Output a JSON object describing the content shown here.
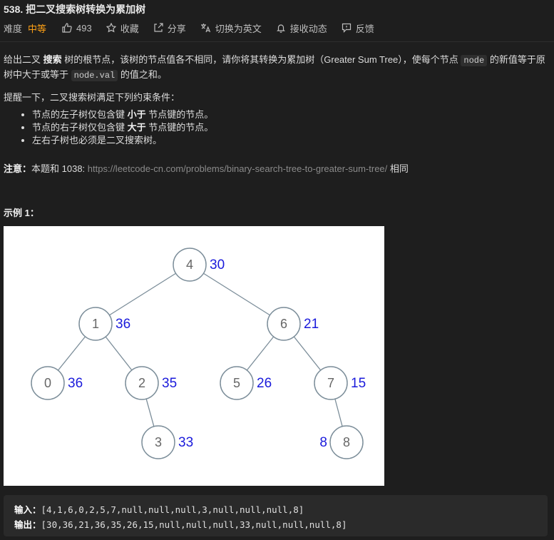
{
  "header": {
    "title": "538. 把二叉搜索树转换为累加树"
  },
  "toolbar": {
    "difficulty_label": "难度",
    "difficulty_value": "中等",
    "likes_count": "493",
    "favorite_label": "收藏",
    "share_label": "分享",
    "translate_label": "切换为英文",
    "notify_label": "接收动态",
    "feedback_label": "反馈"
  },
  "description": {
    "p1_a": "给出二叉 ",
    "p1_bold": "搜索",
    "p1_b": " 树的根节点，该树的节点值各不相同，请你将其转换为累加树（Greater Sum Tree），使每个节点 ",
    "p1_code1": "node",
    "p1_c": " 的新值等于原树中大于或等于 ",
    "p1_code2": "node.val",
    "p1_d": " 的值之和。",
    "reminder": "提醒一下，二叉搜索树满足下列约束条件：",
    "constraints": [
      {
        "a": "节点的左子树仅包含键 ",
        "b": "小于",
        "c": " 节点键的节点。"
      },
      {
        "a": "节点的右子树仅包含键 ",
        "b": "大于",
        "c": " 节点键的节点。"
      },
      {
        "a": "左右子树也必须是二叉搜索树。",
        "b": "",
        "c": ""
      }
    ],
    "note_label": "注意：",
    "note_text": "本题和 1038: ",
    "note_link": "https://leetcode-cn.com/problems/binary-search-tree-to-greater-sum-tree/",
    "note_tail": " 相同"
  },
  "example": {
    "title": "示例 1：",
    "input_label": "输入：",
    "input_value": "[4,1,6,0,2,5,7,null,null,null,3,null,null,null,8]",
    "output_label": "输出：",
    "output_value": "[30,36,21,36,35,26,15,null,null,null,33,null,null,null,8]"
  },
  "tree": {
    "nodes": [
      {
        "id": "n4",
        "val": "4",
        "sum": "30"
      },
      {
        "id": "n1",
        "val": "1",
        "sum": "36"
      },
      {
        "id": "n6",
        "val": "6",
        "sum": "21"
      },
      {
        "id": "n0",
        "val": "0",
        "sum": "36"
      },
      {
        "id": "n2",
        "val": "2",
        "sum": "35"
      },
      {
        "id": "n5",
        "val": "5",
        "sum": "26"
      },
      {
        "id": "n7",
        "val": "7",
        "sum": "15"
      },
      {
        "id": "n3",
        "val": "3",
        "sum": "33"
      },
      {
        "id": "n8",
        "val": "8",
        "sum": "8"
      }
    ],
    "edges": [
      [
        "n4",
        "n1"
      ],
      [
        "n4",
        "n6"
      ],
      [
        "n1",
        "n0"
      ],
      [
        "n1",
        "n2"
      ],
      [
        "n6",
        "n5"
      ],
      [
        "n6",
        "n7"
      ],
      [
        "n2",
        "n3"
      ],
      [
        "n7",
        "n8"
      ]
    ],
    "sum_color": "#1a1adb",
    "node_stroke": "#7b8d99",
    "edge_color": "#7b8d99"
  }
}
